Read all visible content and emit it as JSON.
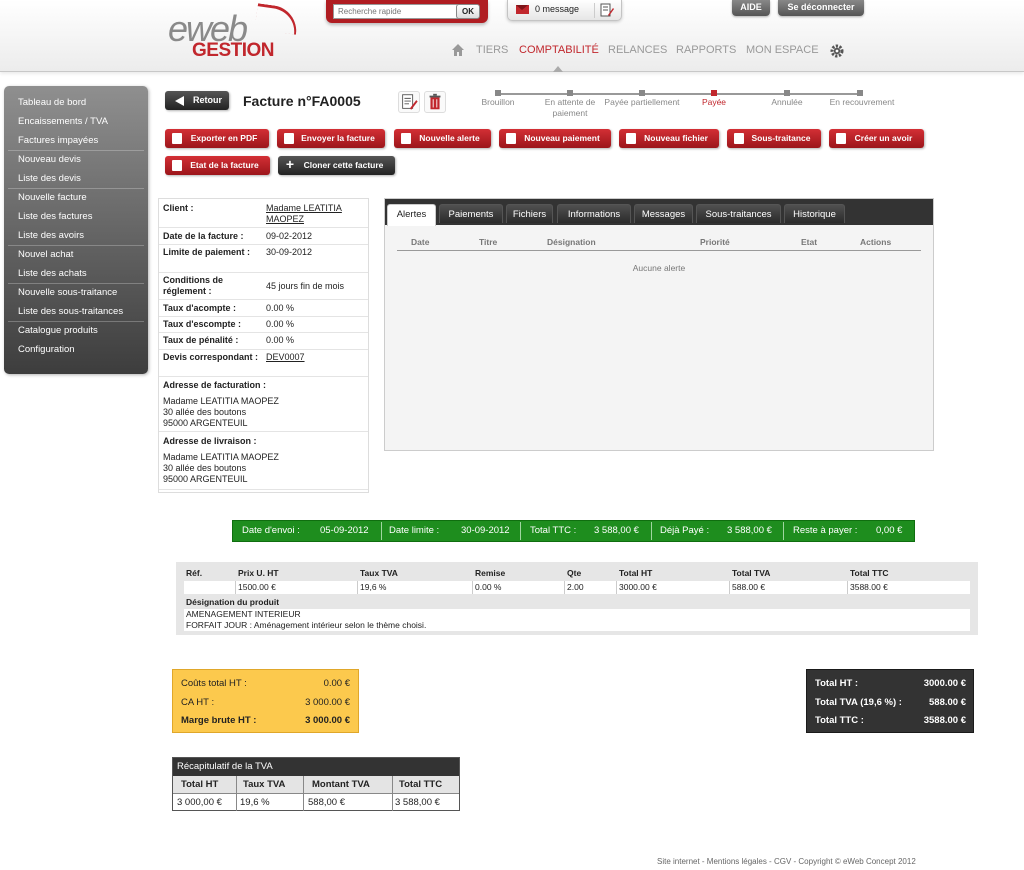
{
  "header": {
    "logo_top": "eweb",
    "logo_bottom": "GESTION",
    "search_placeholder": "Recherche rapide",
    "search_ok": "OK",
    "messages": "0 message",
    "help": "AIDE",
    "logout": "Se déconnecter",
    "nav": [
      "TIERS",
      "COMPTABILITÉ",
      "RELANCES",
      "RAPPORTS",
      "MON ESPACE"
    ]
  },
  "colors": {
    "accent": "#c1272d",
    "dark": "#333333",
    "green": "#1e8d1e",
    "yellow": "#fcc94d"
  },
  "sidebar": {
    "items": [
      "Tableau de bord",
      "Encaissements / TVA",
      "Factures impayées",
      "Nouveau devis",
      "Liste des devis",
      "Nouvelle facture",
      "Liste des factures",
      "Liste des avoirs",
      "Nouvel achat",
      "Liste des achats",
      "Nouvelle sous-traitance",
      "Liste des sous-traitances",
      "Catalogue produits",
      "Configuration"
    ]
  },
  "page": {
    "back": "Retour",
    "title": "Facture n°FA0005"
  },
  "steps": [
    {
      "label": "Brouillon",
      "active": false
    },
    {
      "label": "En attente de paiement",
      "active": false
    },
    {
      "label": "Payée partiellement",
      "active": false
    },
    {
      "label": "Payée",
      "active": true
    },
    {
      "label": "Annulée",
      "active": false
    },
    {
      "label": "En recouvrement",
      "active": false
    }
  ],
  "actions": [
    "Exporter en PDF",
    "Envoyer la facture",
    "Nouvelle alerte",
    "Nouveau paiement",
    "Nouveau fichier",
    "Sous-traitance",
    "Créer un avoir",
    "Etat de la facture",
    "Cloner cette facture"
  ],
  "client": {
    "client_label": "Client :",
    "client_value": "Madame LEATITIA MAOPEZ",
    "date_label": "Date de la facture :",
    "date_value": "09-02-2012",
    "limit_label": "Limite de paiement :",
    "limit_value": "30-09-2012",
    "conditions_label": "Conditions de réglement :",
    "conditions_value": "45 jours fin de mois",
    "acompte_label": "Taux d'acompte :",
    "acompte_value": "0.00 %",
    "escompte_label": "Taux d'escompte :",
    "escompte_value": "0.00 %",
    "penalite_label": "Taux de pénalité :",
    "penalite_value": "0.00 %",
    "devis_label": "Devis correspondant :",
    "devis_value": "DEV0007",
    "billing_label": "Adresse de facturation :",
    "billing": [
      "Madame LEATITIA MAOPEZ",
      "30 allée des boutons",
      "95000 ARGENTEUIL"
    ],
    "shipping_label": "Adresse de livraison :",
    "shipping": [
      "Madame LEATITIA MAOPEZ",
      "30 allée des boutons",
      "95000 ARGENTEUIL"
    ]
  },
  "tabs": {
    "labels": [
      "Alertes",
      "Paiements",
      "Fichiers",
      "Informations",
      "Messages",
      "Sous-traitances",
      "Historique"
    ],
    "columns": [
      "Date",
      "Titre",
      "Désignation",
      "Priorité",
      "Etat",
      "Actions"
    ],
    "empty": "Aucune alerte"
  },
  "summary": {
    "send_label": "Date d'envoi :",
    "send_value": "05-09-2012",
    "limit_label": "Date limite :",
    "limit_value": "30-09-2012",
    "ttc_label": "Total TTC :",
    "ttc_value": "3 588,00 €",
    "paid_label": "Déjà Payé :",
    "paid_value": "3 588,00 €",
    "rest_label": "Reste à payer :",
    "rest_value": "0,00 €"
  },
  "product": {
    "headers": [
      "Réf.",
      "Prix U. HT",
      "Taux TVA",
      "Remise",
      "Qte",
      "Total HT",
      "Total TVA",
      "Total TTC"
    ],
    "row": [
      "",
      "1500.00 €",
      "19,6 %",
      "0.00 %",
      "2.00",
      "3000.00 €",
      "588.00 €",
      "3588.00 €"
    ],
    "designation_label": "Désignation du produit",
    "designation": [
      "AMENAGEMENT INTERIEUR",
      "FORFAIT JOUR : Aménagement intérieur selon le thème choisi."
    ]
  },
  "costs": {
    "cost_label": "Coûts total HT :",
    "cost_value": "0.00 €",
    "ca_label": "CA HT :",
    "ca_value": "3 000.00 €",
    "margin_label": "Marge brute HT :",
    "margin_value": "3 000.00 €"
  },
  "totals": {
    "ht_label": "Total HT :",
    "ht_value": "3000.00 €",
    "tva_label": "Total TVA (19,6 %) :",
    "tva_value": "588.00 €",
    "ttc_label": "Total TTC :",
    "ttc_value": "3588.00 €"
  },
  "tva_recap": {
    "title": "Récapitulatif de la TVA",
    "headers": [
      "Total HT",
      "Taux TVA",
      "Montant TVA",
      "Total TTC"
    ],
    "row": [
      "3 000,00 €",
      "19,6 %",
      "588,00 €",
      "3 588,00 €"
    ]
  },
  "footer": "Site internet - Mentions légales - CGV - Copyright © eWeb Concept 2012"
}
